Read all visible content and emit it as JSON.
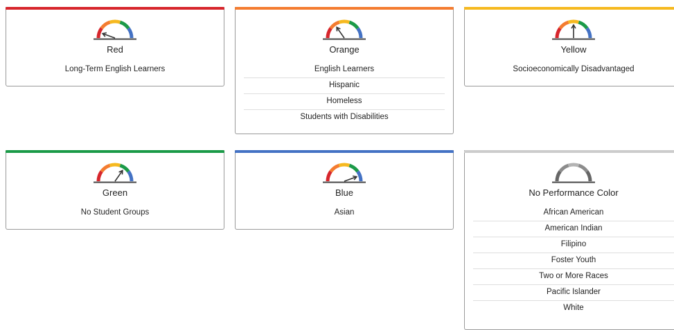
{
  "colors": {
    "red": "#d7262c",
    "orange": "#f47c30",
    "yellow": "#f6b91f",
    "green": "#1b9a48",
    "blue": "#4472c4",
    "gray": "#cccccc",
    "needle": "#333333"
  },
  "cards": [
    {
      "key": "red",
      "title": "Red",
      "icon": "gauge-icon-red",
      "groups": [
        "Long-Term English Learners"
      ]
    },
    {
      "key": "orange",
      "title": "Orange",
      "icon": "gauge-icon-orange",
      "groups": [
        "English Learners",
        "Hispanic",
        "Homeless",
        "Students with Disabilities"
      ]
    },
    {
      "key": "yellow",
      "title": "Yellow",
      "icon": "gauge-icon-yellow",
      "groups": [
        "Socioeconomically Disadvantaged"
      ]
    },
    {
      "key": "green",
      "title": "Green",
      "icon": "gauge-icon-green",
      "groups": [
        "No Student Groups"
      ]
    },
    {
      "key": "blue",
      "title": "Blue",
      "icon": "gauge-icon-blue",
      "groups": [
        "Asian"
      ]
    },
    {
      "key": "none",
      "title": "No Performance Color",
      "icon": "gauge-icon-no-color",
      "groups": [
        "African American",
        "American Indian",
        "Filipino",
        "Foster Youth",
        "Two or More Races",
        "Pacific Islander",
        "White"
      ]
    }
  ]
}
